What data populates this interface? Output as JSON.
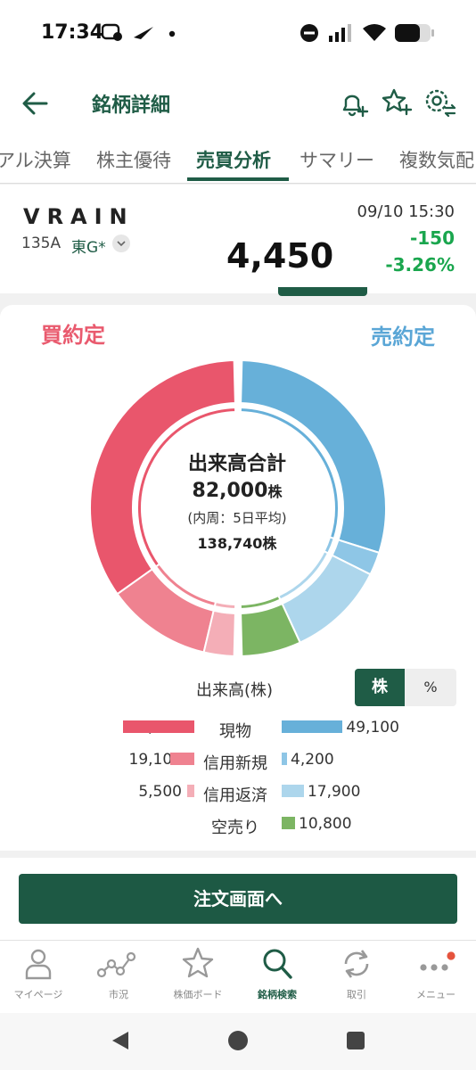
{
  "status_bar": {
    "time": "17:34"
  },
  "header": {
    "title": "銘柄詳細"
  },
  "tabs": [
    {
      "label": "アル決算"
    },
    {
      "label": "株主優待"
    },
    {
      "label": "売買分析",
      "active": true
    },
    {
      "label": "サマリー"
    },
    {
      "label": "複数気配"
    }
  ],
  "stock": {
    "name": "VRAIN",
    "code": "135A",
    "market": "東G*",
    "price": "4,450",
    "datetime": "09/10 15:30",
    "change": "-150",
    "change_pct": "-3.26%"
  },
  "analysis": {
    "buy_label": "買約定",
    "sell_label": "売約定",
    "center_title": "出来高合計",
    "total": "82,000",
    "total_unit": "株",
    "avg_note": "(内周：5日平均)",
    "avg_total": "138,740",
    "avg_unit": "株",
    "volume_title": "出来高(株)",
    "unit_toggle": {
      "shares": "株",
      "percent": "%",
      "selected": "株"
    },
    "colors": {
      "buy_cash": "#e9566c",
      "buy_margin_new": "#ef8290",
      "buy_margin_repay": "#f4aeb7",
      "sell_cash": "#67b0d9",
      "sell_margin_new": "#8ec6e6",
      "sell_margin_repay": "#add6ec",
      "short_sell": "#7cb563"
    }
  },
  "legend": {
    "rows": [
      {
        "category": "現物",
        "buy": "57,400",
        "sell": "49,100"
      },
      {
        "category": "信用新規",
        "buy": "19,100",
        "sell": "4,200"
      },
      {
        "category": "信用返済",
        "buy": "5,500",
        "sell": "17,900"
      },
      {
        "category": "空売り",
        "buy": "",
        "sell": "10,800"
      }
    ]
  },
  "order_button": {
    "label": "注文画面へ"
  },
  "bottom_nav": [
    {
      "label": "マイページ",
      "icon": "person-icon"
    },
    {
      "label": "市況",
      "icon": "market-chart-icon"
    },
    {
      "label": "株価ボード",
      "icon": "star-icon"
    },
    {
      "label": "銘柄検索",
      "icon": "search-icon",
      "active": true
    },
    {
      "label": "取引",
      "icon": "refresh-icon"
    },
    {
      "label": "メニュー",
      "icon": "more-dots-icon"
    }
  ]
}
